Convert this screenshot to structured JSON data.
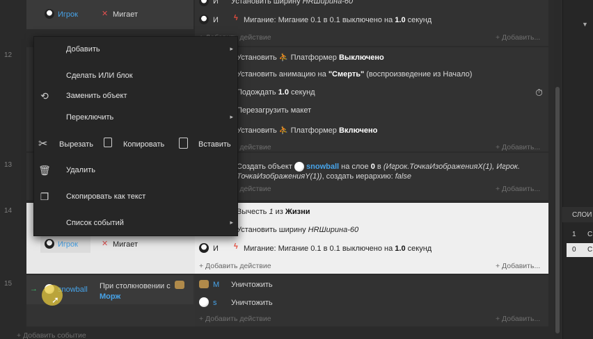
{
  "row_numbers": [
    "12",
    "13",
    "14",
    "15"
  ],
  "top_row": {
    "cond_object": "Игрок",
    "cond_text": "Мигает",
    "action1_object": "И",
    "action1_text_pre": "Установить ширину",
    "action1_text_val": "HRШирина-60",
    "action2_object": "И",
    "action2_text": "Мигание: Мигание 0.1 в 0.1 выключено на",
    "action2_bold": "1.0",
    "action2_suffix": "секунд",
    "add_action": "+ Добавить действие",
    "add_right": "+ Добавить..."
  },
  "row12": {
    "a1_pre": "Установить",
    "a1_platformer": "Платформер",
    "a1_bold": "Выключено",
    "a2_pre": "Установить анимацию на",
    "a2_bold": "\"Смерть\"",
    "a2_post": "(воспроизведение из Начало)",
    "a3_pre": "Подождать",
    "a3_bold": "1.0",
    "a3_post": "секунд",
    "a4": "Перезагрузить макет",
    "a5_pre": "Установить",
    "a5_platformer": "Платформер",
    "a5_bold": "Включено",
    "add_action": "+ Добавить действие",
    "add_right": "+ Добавить..."
  },
  "row13": {
    "a1_pre": "Создать объект",
    "a1_obj": "snowball",
    "a1_mid": "на слое",
    "a1_bold": "0",
    "a1_mid2": "в",
    "a1_italic1": "(Игрок.ТочкаИзображенияX(1), Игрок.",
    "a1_italic2": "ТочкаИзображенияY(1))",
    "a1_post": ", создать иерархию:",
    "a1_false": "false",
    "add_action": "+ Добавить действие",
    "add_right": "+ Добавить..."
  },
  "row14": {
    "a0_pre": "Вычесть",
    "a0_italic": "1",
    "a0_mid": "из",
    "a0_bold": "Жизни",
    "a1_pre": "Установить ширину",
    "a1_val": "HRШирина-60",
    "cond_object": "Игрок",
    "cond_text": "Мигает",
    "a2_object": "И",
    "a2_text": "Мигание: Мигание 0.1 в 0.1 выключено на",
    "a2_bold": "1.0",
    "a2_suffix": "секунд",
    "add_action": "+ Добавить действие",
    "add_right": "+ Добавить..."
  },
  "row15": {
    "cond_object": "snowball",
    "cond_text": "При столкновении с",
    "cond_target": "Морж",
    "a1_object": "М",
    "a1_text": "Уничтожить",
    "a2_object": "s",
    "a2_text": "Уничтожить",
    "add_action": "+ Добавить действие",
    "add_right": "+ Добавить..."
  },
  "bottom_add_event": "Добавить событие",
  "right_panel": {
    "header": "СЛОИ",
    "col1": "1",
    "col2": "С",
    "val1": "0",
    "val2": "С"
  },
  "context_menu": {
    "items": [
      {
        "label": "Добавить",
        "submenu": "▸"
      },
      {
        "label": "Сделать ИЛИ блок"
      },
      {
        "label": "Заменить объект"
      },
      {
        "label": "Переключить",
        "submenu": "▸"
      },
      {
        "label": "Удалить"
      },
      {
        "label": "Скопировать как текст"
      },
      {
        "label": "Список событий",
        "submenu": "▸"
      }
    ],
    "tools": {
      "cut": "Вырезать",
      "copy": "Копировать",
      "paste": "Вставить"
    }
  },
  "colors": {
    "accent_blue": "#47a3e8",
    "flame_red": "#e84c3d",
    "selected_bg": "#e8e8e8"
  }
}
